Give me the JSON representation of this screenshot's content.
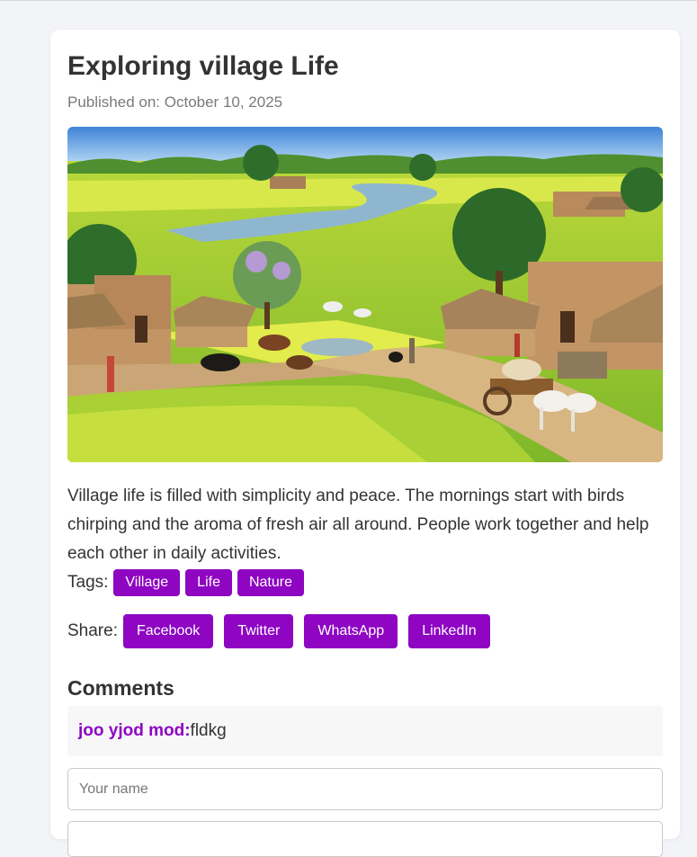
{
  "post": {
    "title": "Exploring village Life",
    "published": "Published on: October 10, 2025",
    "image_alt": "Village landscape with mud houses, river, mustard fields and bullock cart",
    "body": "Village life is filled with simplicity and peace. The mornings start with birds chirping and the aroma of fresh air all around. People work together and help each other in daily activities."
  },
  "tags": {
    "label": "Tags:",
    "items": [
      "Village",
      "Life",
      "Nature"
    ]
  },
  "share": {
    "label": "Share:",
    "buttons": [
      "Facebook",
      "Twitter",
      "WhatsApp",
      "LinkedIn"
    ]
  },
  "comments": {
    "title": "Comments",
    "items": [
      {
        "author": "joo yjod mod:",
        "text": "fldkg"
      }
    ],
    "name_placeholder": "Your name"
  },
  "colors": {
    "accent": "#8e05c2",
    "background": "#f3f4f8",
    "text": "#333333"
  }
}
